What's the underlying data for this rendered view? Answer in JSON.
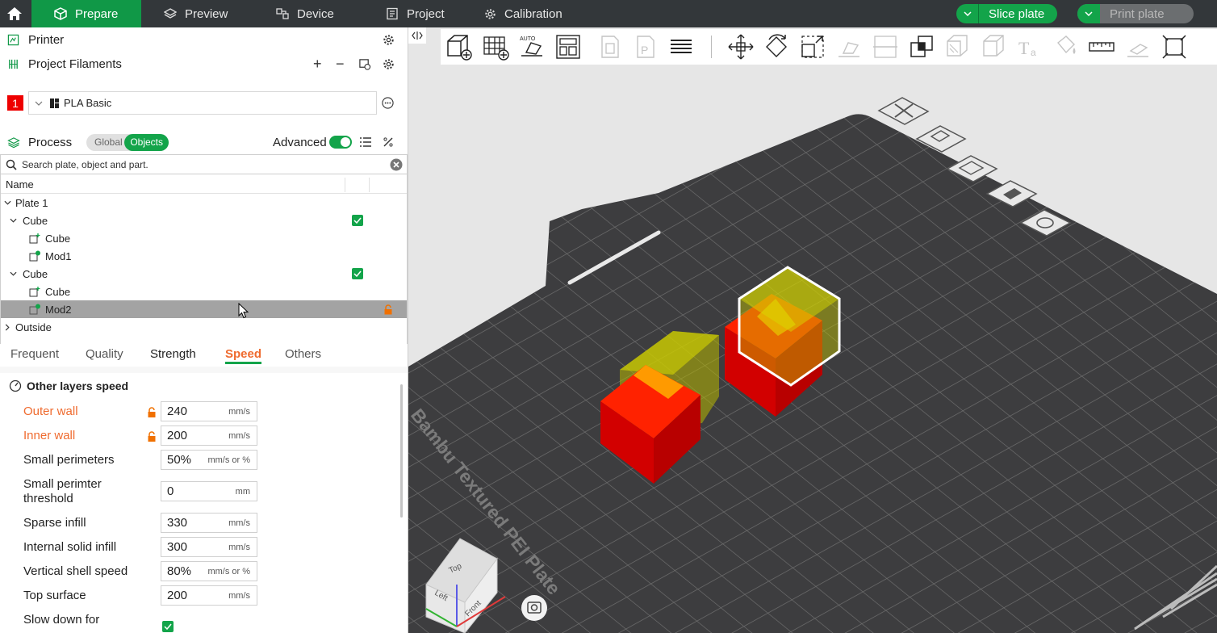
{
  "topbar": {
    "tabs": [
      {
        "label": "Prepare"
      },
      {
        "label": "Preview"
      },
      {
        "label": "Device"
      },
      {
        "label": "Project"
      },
      {
        "label": "Calibration"
      }
    ],
    "slice_label": "Slice plate",
    "print_label": "Print plate"
  },
  "sidebar": {
    "printer_label": "Printer",
    "filaments_label": "Project Filaments",
    "filament_index": "1",
    "filament_name": "PLA Basic",
    "process_label": "Process",
    "process_global": "Global",
    "process_objects": "Objects",
    "advanced_label": "Advanced",
    "search_placeholder": "Search plate, object and part.",
    "tree_header": "Name",
    "tree": [
      {
        "label": "Plate 1"
      },
      {
        "label": "Cube"
      },
      {
        "label": "Cube"
      },
      {
        "label": "Mod1"
      },
      {
        "label": "Cube"
      },
      {
        "label": "Cube"
      },
      {
        "label": "Mod2"
      },
      {
        "label": "Outside"
      }
    ],
    "param_tabs": [
      "Frequent",
      "Quality",
      "Strength",
      "Speed",
      "Others"
    ],
    "section_title": "Other layers speed",
    "params": [
      {
        "label": "Outer wall",
        "value": "240",
        "unit": "mm/s"
      },
      {
        "label": "Inner wall",
        "value": "200",
        "unit": "mm/s"
      },
      {
        "label": "Small perimeters",
        "value": "50%",
        "unit": "mm/s or %"
      },
      {
        "label": "Small perimter",
        "label2": "threshold",
        "value": "0",
        "unit": "mm"
      },
      {
        "label": "Sparse infill",
        "value": "330",
        "unit": "mm/s"
      },
      {
        "label": "Internal solid infill",
        "value": "300",
        "unit": "mm/s"
      },
      {
        "label": "Vertical shell speed",
        "value": "80%",
        "unit": "mm/s or %"
      },
      {
        "label": "Top surface",
        "value": "200",
        "unit": "mm/s"
      },
      {
        "label": "Slow down for"
      }
    ]
  },
  "viewport": {
    "plate_label": "Bambu Textured PEI Plate",
    "cube_top": "Top",
    "cube_left": "Left",
    "cube_front": "Front"
  },
  "colors": {
    "accent": "#109847",
    "highlight": "#ef6b2f",
    "bed": "#3d3d3f",
    "part_red": "#e50000",
    "modifier_yellow": "#c8c800"
  }
}
